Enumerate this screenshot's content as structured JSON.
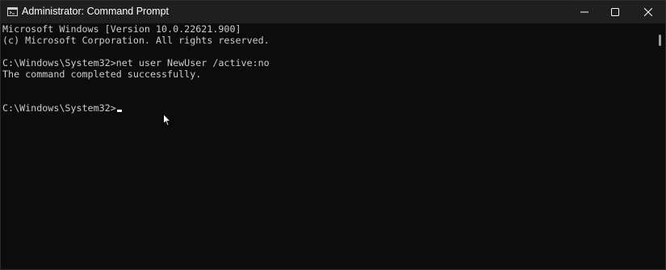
{
  "window": {
    "title": "Administrator: Command Prompt",
    "app_icon": "command-prompt-icon"
  },
  "titlebar_buttons": {
    "minimize_icon": "minimize-icon",
    "maximize_icon": "maximize-icon",
    "close_icon": "close-icon"
  },
  "console": {
    "lines": [
      "Microsoft Windows [Version 10.0.22621.900]",
      "(c) Microsoft Corporation. All rights reserved.",
      "",
      "C:\\Windows\\System32>net user NewUser /active:no",
      "The command completed successfully.",
      "",
      "C:\\Windows\\System32>"
    ],
    "background_color": "#0c0c0c",
    "text_color": "#cccccc"
  }
}
